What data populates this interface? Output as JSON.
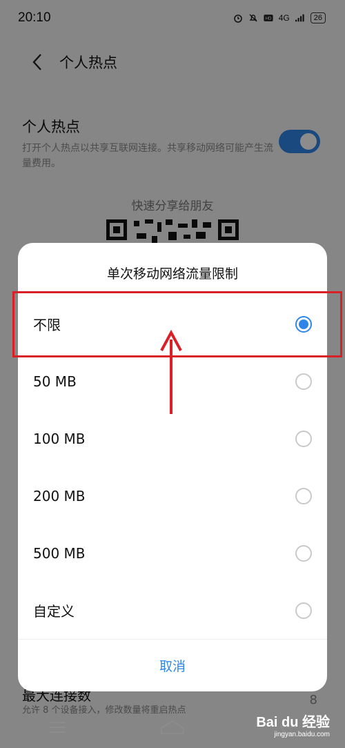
{
  "status_bar": {
    "time": "20:10",
    "network_label": "4G",
    "battery": "26"
  },
  "page": {
    "title": "个人热点",
    "hotspot_label": "个人热点",
    "hotspot_desc": "打开个人热点以共享互联网连接。共享移动网络可能产生流量费用。",
    "hotspot_enabled": true,
    "share_label": "快速分享给朋友",
    "max_connections_label": "最大连接数",
    "max_connections_desc": "允许 8 个设备接入，修改数量将重启热点",
    "max_connections_value": "8"
  },
  "dialog": {
    "title": "单次移动网络流量限制",
    "options": [
      {
        "label": "不限",
        "selected": true
      },
      {
        "label": "50  MB",
        "selected": false
      },
      {
        "label": "100  MB",
        "selected": false
      },
      {
        "label": "200  MB",
        "selected": false
      },
      {
        "label": "500  MB",
        "selected": false
      },
      {
        "label": "自定义",
        "selected": false
      }
    ],
    "cancel_label": "取消"
  },
  "watermark": {
    "brand": "Bai du 经验",
    "url": "jingyan.baidu.com"
  },
  "colors": {
    "accent": "#2f86e8",
    "annotation": "#d92027"
  }
}
